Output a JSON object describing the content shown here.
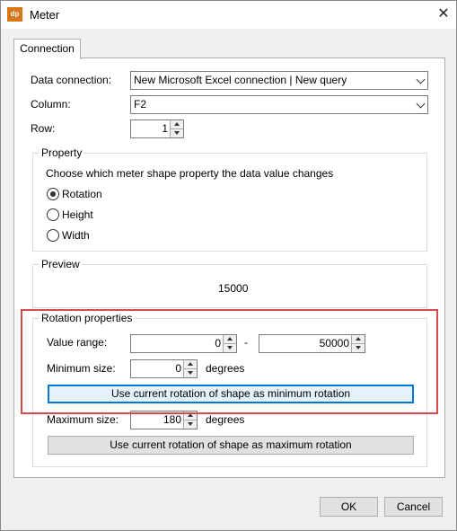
{
  "window": {
    "title": "Meter",
    "app_icon_text": "dp",
    "close_glyph": "✕"
  },
  "tabs": [
    {
      "label": "Connection",
      "selected": true
    }
  ],
  "connection": {
    "data_connection_label": "Data connection:",
    "data_connection_value": "New Microsoft Excel connection | New query",
    "column_label": "Column:",
    "column_value": "F2",
    "row_label": "Row:",
    "row_value": "1"
  },
  "property": {
    "title": "Property",
    "description": "Choose which meter shape property the data value changes",
    "options": [
      {
        "label": "Rotation",
        "selected": true
      },
      {
        "label": "Height",
        "selected": false
      },
      {
        "label": "Width",
        "selected": false
      }
    ]
  },
  "preview": {
    "title": "Preview",
    "value": "15000"
  },
  "rotation": {
    "title": "Rotation properties",
    "value_range_label": "Value range:",
    "range_min": "0",
    "range_separator": "-",
    "range_max": "50000",
    "min_size_label": "Minimum size:",
    "min_size_value": "0",
    "min_unit": "degrees",
    "use_min_button": "Use current rotation of shape as minimum rotation",
    "max_size_label": "Maximum size:",
    "max_size_value": "180",
    "max_unit": "degrees",
    "use_max_button": "Use current rotation of shape as maximum rotation"
  },
  "footer": {
    "ok": "OK",
    "cancel": "Cancel"
  },
  "colors": {
    "highlight": "#d94a4a",
    "focus": "#0078d7",
    "app_icon": "#d6771a"
  }
}
